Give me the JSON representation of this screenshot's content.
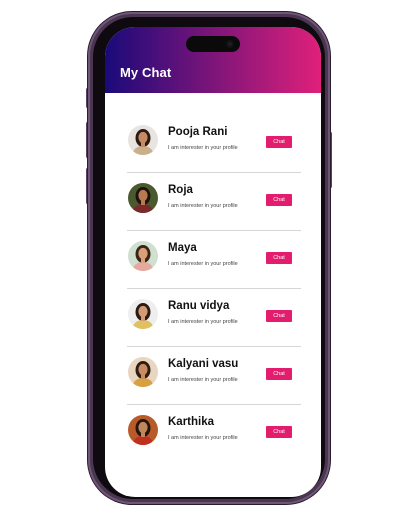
{
  "header": {
    "title": "My Chat"
  },
  "colors": {
    "header_gradient_start": "#1a0a7a",
    "header_gradient_end": "#e0207a",
    "chat_button": "#e41c6d"
  },
  "chats": [
    {
      "name": "Pooja Rani",
      "message": "I am interester in your profile",
      "button_label": "Chat",
      "avatar_icon": "woman-portrait-icon",
      "skin": "#c58b63",
      "hair": "#2a1a12",
      "bg": "#e9e4df",
      "cloth": "#c9b08a"
    },
    {
      "name": "Roja",
      "message": "I am interester in your profile",
      "button_label": "Chat",
      "avatar_icon": "woman-portrait-icon",
      "skin": "#b77a52",
      "hair": "#1e120c",
      "bg": "#4a5a2e",
      "cloth": "#7a2a2a"
    },
    {
      "name": "Maya",
      "message": "I am interester in your profile",
      "button_label": "Chat",
      "avatar_icon": "woman-portrait-icon",
      "skin": "#d9a07a",
      "hair": "#3a2418",
      "bg": "#cfe0cf",
      "cloth": "#e6a9a0"
    },
    {
      "name": "Ranu vidya",
      "message": "I am interester in your profile",
      "button_label": "Chat",
      "avatar_icon": "woman-portrait-icon",
      "skin": "#d39a73",
      "hair": "#2a1a12",
      "bg": "#eeeeee",
      "cloth": "#e0c060"
    },
    {
      "name": "Kalyani vasu",
      "message": "I am interester in your profile",
      "button_label": "Chat",
      "avatar_icon": "woman-portrait-icon",
      "skin": "#c98c62",
      "hair": "#2e1c12",
      "bg": "#e8d6c0",
      "cloth": "#d8a040"
    },
    {
      "name": "Karthika",
      "message": "I am interester in your profile",
      "button_label": "Chat",
      "avatar_icon": "woman-portrait-icon",
      "skin": "#c2865c",
      "hair": "#24160e",
      "bg": "#b85a2a",
      "cloth": "#c03020"
    }
  ]
}
